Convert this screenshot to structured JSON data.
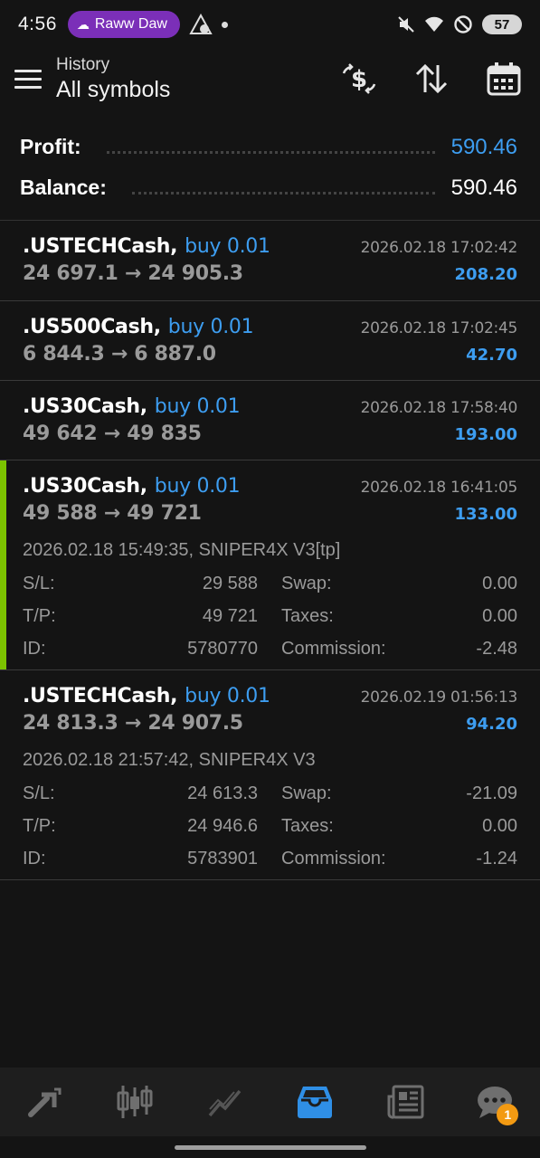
{
  "status": {
    "time": "4:56",
    "media_pill": "Raww Daw",
    "battery": "57"
  },
  "header": {
    "subtitle": "History",
    "title": "All symbols"
  },
  "summary": {
    "profit_label": "Profit:",
    "profit_value": "590.46",
    "balance_label": "Balance:",
    "balance_value": "590.46"
  },
  "trades": [
    {
      "symbol": ".USTECHCash,",
      "side": "buy 0.01",
      "datetime": "2026.02.18 17:02:42",
      "prices": "24 697.1 → 24 905.3",
      "profit": "208.20"
    },
    {
      "symbol": ".US500Cash,",
      "side": "buy 0.01",
      "datetime": "2026.02.18 17:02:45",
      "prices": "6 844.3 → 6 887.0",
      "profit": "42.70"
    },
    {
      "symbol": ".US30Cash,",
      "side": "buy 0.01",
      "datetime": "2026.02.18 17:58:40",
      "prices": "49 642 → 49 835",
      "profit": "193.00"
    },
    {
      "symbol": ".US30Cash,",
      "side": "buy 0.01",
      "datetime": "2026.02.18 16:41:05",
      "prices": "49 588 → 49 721",
      "profit": "133.00",
      "open_info": "2026.02.18 15:49:35, SNIPER4X V3[tp]",
      "sl_label": "S/L:",
      "sl": "29 588",
      "swap_label": "Swap:",
      "swap": "0.00",
      "tp_label": "T/P:",
      "tp": "49 721",
      "taxes_label": "Taxes:",
      "taxes": "0.00",
      "id_label": "ID:",
      "id": "5780770",
      "commission_label": "Commission:",
      "commission": "-2.48"
    },
    {
      "symbol": ".USTECHCash,",
      "side": "buy 0.01",
      "datetime": "2026.02.19 01:56:13",
      "prices": "24 813.3 → 24 907.5",
      "profit": "94.20",
      "open_info": "2026.02.18 21:57:42, SNIPER4X V3",
      "sl_label": "S/L:",
      "sl": "24 613.3",
      "swap_label": "Swap:",
      "swap": "-21.09",
      "tp_label": "T/P:",
      "tp": "24 946.6",
      "taxes_label": "Taxes:",
      "taxes": "0.00",
      "id_label": "ID:",
      "id": "5783901",
      "commission_label": "Commission:",
      "commission": "-1.24"
    }
  ],
  "bottom_nav": {
    "chat_badge": "1",
    "active": "history"
  },
  "colors": {
    "accent_blue": "#3d9df0",
    "selected_bar": "#7cc300",
    "badge": "#f39a12"
  }
}
